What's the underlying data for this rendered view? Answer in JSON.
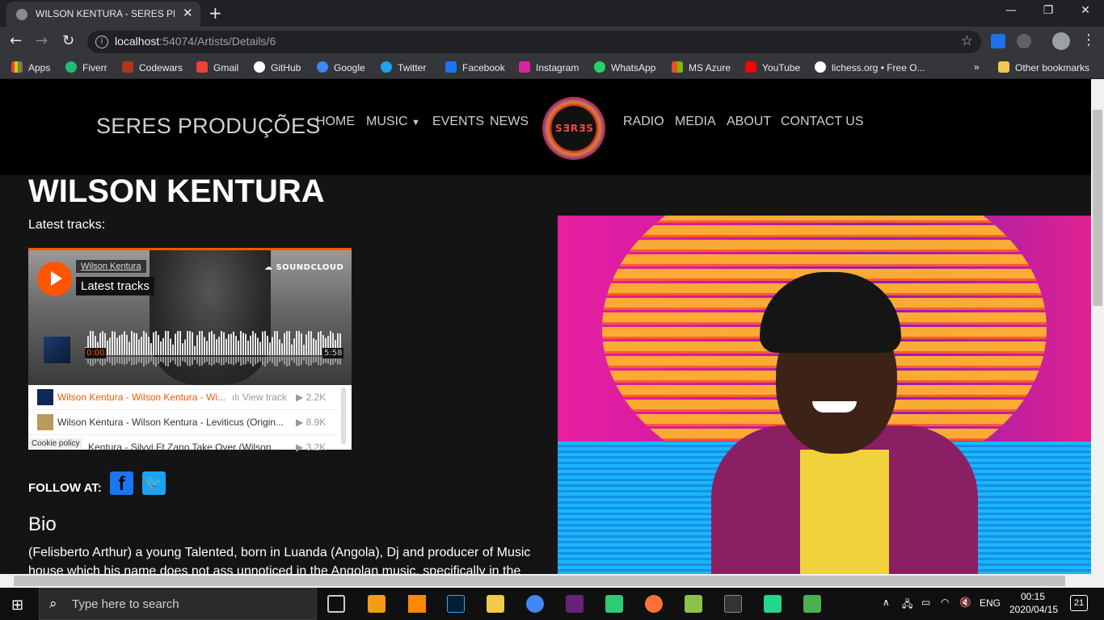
{
  "browser": {
    "tab_title": "WILSON KENTURA - SERES PRODU",
    "url_host": "localhost",
    "url_path": ":54074/Artists/Details/6",
    "bookmarks": [
      "Apps",
      "Fiverr",
      "Codewars",
      "Gmail",
      "GitHub",
      "Google",
      "Twitter",
      "Facebook",
      "Instagram",
      "WhatsApp",
      "MS Azure",
      "YouTube",
      "lichess.org • Free O..."
    ],
    "more_bookmarks": "»",
    "other_bookmarks": "Other bookmarks"
  },
  "site": {
    "brand": "SERES PRODUÇÕES",
    "nav": {
      "home": "HOME",
      "music": "MUSIC",
      "events": "EVENTS",
      "news": "NEWS",
      "radio": "RADIO",
      "media": "MEDIA",
      "about": "ABOUT",
      "contact": "CONTACT US"
    },
    "logo_text": "SƎRƎS"
  },
  "artist": {
    "name": "WILSON KENTURA",
    "latest_label": "Latest tracks:",
    "follow_label": "FOLLOW AT:",
    "bio_heading": "Bio",
    "bio_text": "(Felisberto Arthur) a young Talented, born in Luanda (Angola), Dj and producer of Music house which his name does not ass unnoticed in the Angolan music, specifically in the"
  },
  "soundcloud": {
    "user": "Wilson Kentura",
    "title": "Latest tracks",
    "brand": "SOUNDCLOUD",
    "time_current": "0:00",
    "time_total": "5:58",
    "tracks": [
      {
        "name": "Wilson Kentura - Wilson Kentura - Wi...",
        "action": "View track",
        "plays": "2.2K"
      },
      {
        "name": "Wilson Kentura - Wilson Kentura - Leviticus (Origin...",
        "action": "",
        "plays": "8.9K"
      },
      {
        "name": "Kentura - Silvyi Ft Zano Take Over (Wilson...",
        "action": "",
        "plays": "3.2K"
      }
    ],
    "cookie": "Cookie policy"
  },
  "taskbar": {
    "search_placeholder": "Type here to search",
    "lang": "ENG",
    "time": "00:15",
    "date": "2020/04/15",
    "notifications": "21"
  },
  "colors": {
    "accent": "#ff5500",
    "facebook": "#1877f2",
    "twitter": "#1da1f2"
  }
}
